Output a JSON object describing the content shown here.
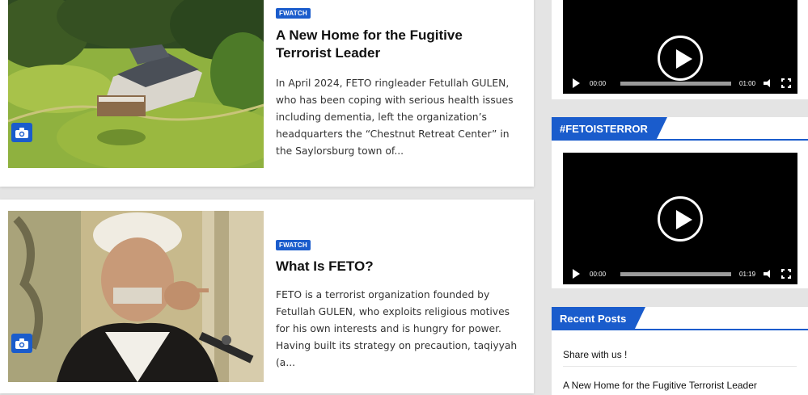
{
  "posts": [
    {
      "tag": "FWATCH",
      "title": "A New Home for the Fugitive Terrorist Leader",
      "excerpt": "In April 2024, FETO ringleader Fetullah GULEN, who has been coping with serious health issues including dementia, left the organization’s headquarters the “Chestnut Retreat Center” in the Saylorsburg town of..."
    },
    {
      "tag": "FWATCH",
      "title": "What Is FETO?",
      "excerpt": "FETO is a terrorist organization founded by Fetullah GULEN, who exploits religious motives for his own interests and is hungry for power. Having built its strategy on precaution, taqiyyah (a..."
    }
  ],
  "sidebar": {
    "video1": {
      "current": "00:00",
      "duration": "01:00"
    },
    "fetoisterror": {
      "title": "#FETOISTERROR",
      "video": {
        "current": "00:00",
        "duration": "01:19"
      }
    },
    "recent": {
      "title": "Recent Posts",
      "items": [
        "Share with us !",
        "A New Home for the Fugitive Terrorist Leader"
      ]
    }
  },
  "colors": {
    "accent": "#1a5ccc",
    "background": "#e4e4e4"
  },
  "icons": {
    "camera": "camera-icon",
    "play": "play-icon",
    "volume": "volume-icon",
    "fullscreen": "fullscreen-icon"
  }
}
